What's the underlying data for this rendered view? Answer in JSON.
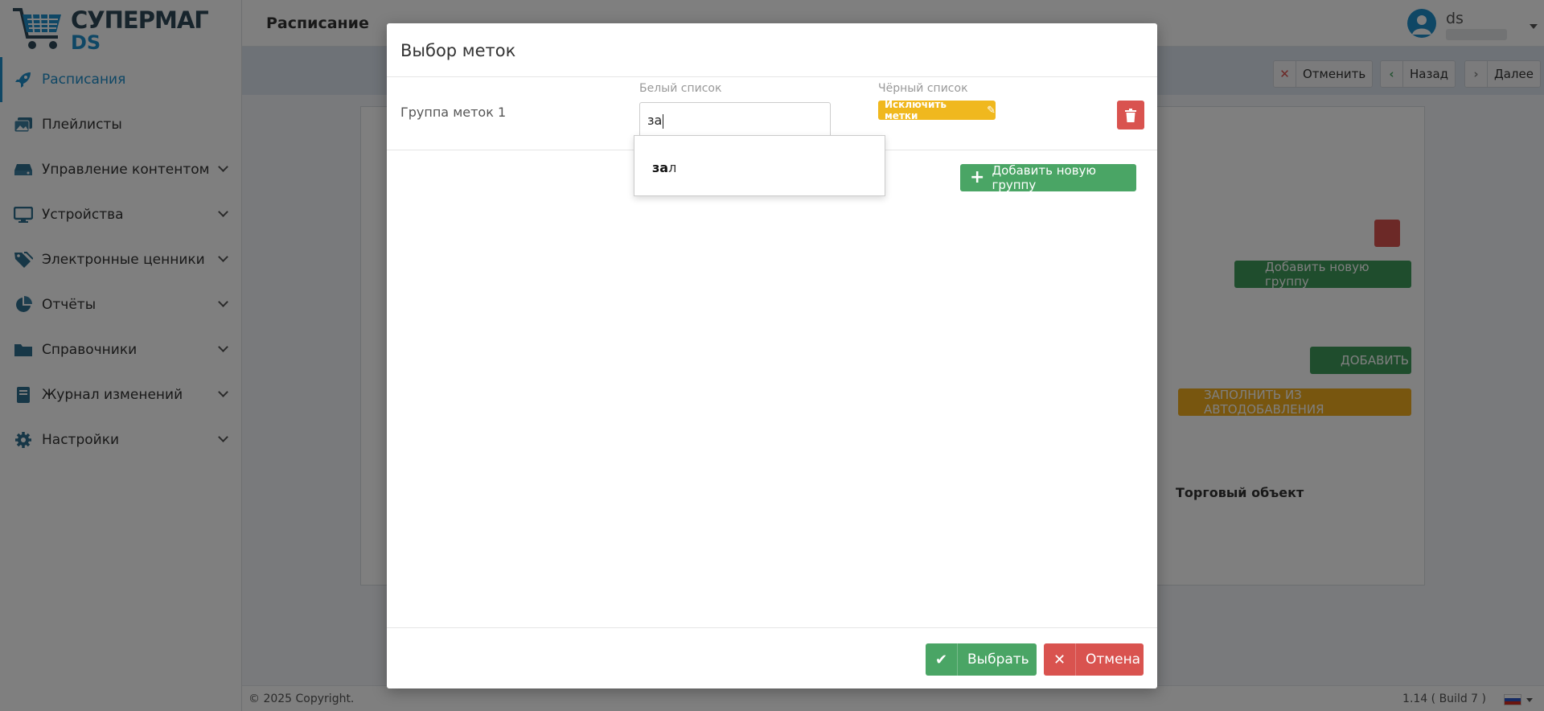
{
  "brand": {
    "name": "СУПЕРМАГ",
    "sub": "DS"
  },
  "sidebar": {
    "items": [
      {
        "label": "Расписания",
        "icon": "rocket-icon",
        "active": true
      },
      {
        "label": "Плейлисты",
        "icon": "images-icon"
      },
      {
        "label": "Управление контентом",
        "icon": "hdd-icon"
      },
      {
        "label": "Устройства",
        "icon": "monitor-icon"
      },
      {
        "label": "Электронные ценники",
        "icon": "tags-icon"
      },
      {
        "label": "Отчёты",
        "icon": "pie-chart-icon"
      },
      {
        "label": "Справочники",
        "icon": "folder-icon"
      },
      {
        "label": "Журнал изменений",
        "icon": "book-icon"
      },
      {
        "label": "Настройки",
        "icon": "gear-icon"
      }
    ]
  },
  "header": {
    "title": "Расписание",
    "user": "ds"
  },
  "toolbar": {
    "cancel": "Отменить",
    "back": "Назад",
    "next": "Далее"
  },
  "background": {
    "add_group": "Добавить новую группу",
    "add": "ДОБАВИТЬ",
    "fill_auto": "ЗАПОЛНИТЬ ИЗ АВТОДОБАВЛЕНИЯ",
    "col_object": "Торговый объект"
  },
  "modal": {
    "title": "Выбор меток",
    "group_label": "Группа меток 1",
    "whitelist_label": "Белый список",
    "whitelist_value": "за",
    "blacklist_label": "Чёрный список",
    "exclude_button": "Исключить метки",
    "suggestion_match": "за",
    "suggestion_rest": "л",
    "add_group_button": "Добавить новую группу",
    "ok_button": "Выбрать",
    "cancel_button": "Отмена"
  },
  "footer": {
    "copyright": "© 2025 Copyright.",
    "version": "1.14 ( Build 7 )"
  },
  "colors": {
    "accent": "#1f8ecb",
    "success": "#4aa565",
    "danger": "#d9534f",
    "warning": "#f0b81e"
  }
}
